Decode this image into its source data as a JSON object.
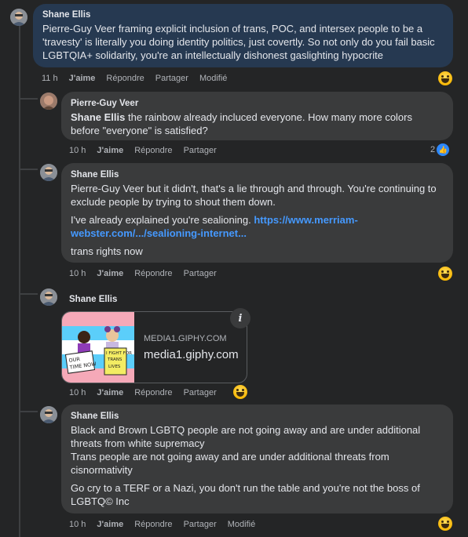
{
  "comments": [
    {
      "author": "Shane Ellis",
      "lines": [
        "Pierre-Guy Veer framing explicit inclusion of trans, POC, and intersex people to be a 'travesty' is literally you doing identity politics, just covertly. So not only do you fail basic LGBTQIA+ solidarity, you're an intellectually dishonest gaslighting hypocrite"
      ],
      "time": "11 h",
      "like": "J'aime",
      "reply": "Répondre",
      "share": "Partager",
      "edited": "Modifié",
      "reaction": "laugh-emoji"
    },
    {
      "author": "Pierre-Guy Veer",
      "mention": "Shane Ellis",
      "text": " the rainbow already incluced everyone. How many more colors before \"everyone\" is satisfied?",
      "time": "10 h",
      "like": "J'aime",
      "reply": "Répondre",
      "share": "Partager",
      "like_count": "2"
    },
    {
      "author": "Shane Ellis",
      "p1": "Pierre-Guy Veer but it didn't, that's a lie through and through. You're continuing to exclude people by trying to shout them down.",
      "p2_prefix": "I've already explained you're sealioning. ",
      "p2_link": "https://www.merriam-webster.com/.../sealioning-internet...",
      "p3": "trans rights now",
      "time": "10 h",
      "like": "J'aime",
      "reply": "Répondre",
      "share": "Partager",
      "reaction": "laugh-emoji"
    },
    {
      "author": "Shane Ellis",
      "gif_domain": "MEDIA1.GIPHY.COM",
      "gif_site": "media1.giphy.com",
      "gif_sign_left": "OUR TIME NOW",
      "gif_sign_right": "I FIGHT FOR TRANS LIVES",
      "time": "10 h",
      "like": "J'aime",
      "reply": "Répondre",
      "share": "Partager",
      "reaction": "laugh-emoji"
    },
    {
      "author": "Shane Ellis",
      "l1": "Black and Brown LGBTQ people are not going away and are under additional threats from white supremacy",
      "l2": "Trans people are not going away and are under additional threats from cisnormativity",
      "l3": "Go cry to a TERF or a Nazi, you don't run the table and you're not the boss of LGBTQ© Inc",
      "time": "10 h",
      "like": "J'aime",
      "reply": "Répondre",
      "share": "Partager",
      "edited": "Modifié",
      "reaction": "laugh-emoji"
    }
  ],
  "colors": {
    "background": "#242526",
    "bubble": "#3a3b3c",
    "highlight_bubble": "#263951",
    "link": "#4599ff",
    "like_blue": "#2d88ff"
  }
}
